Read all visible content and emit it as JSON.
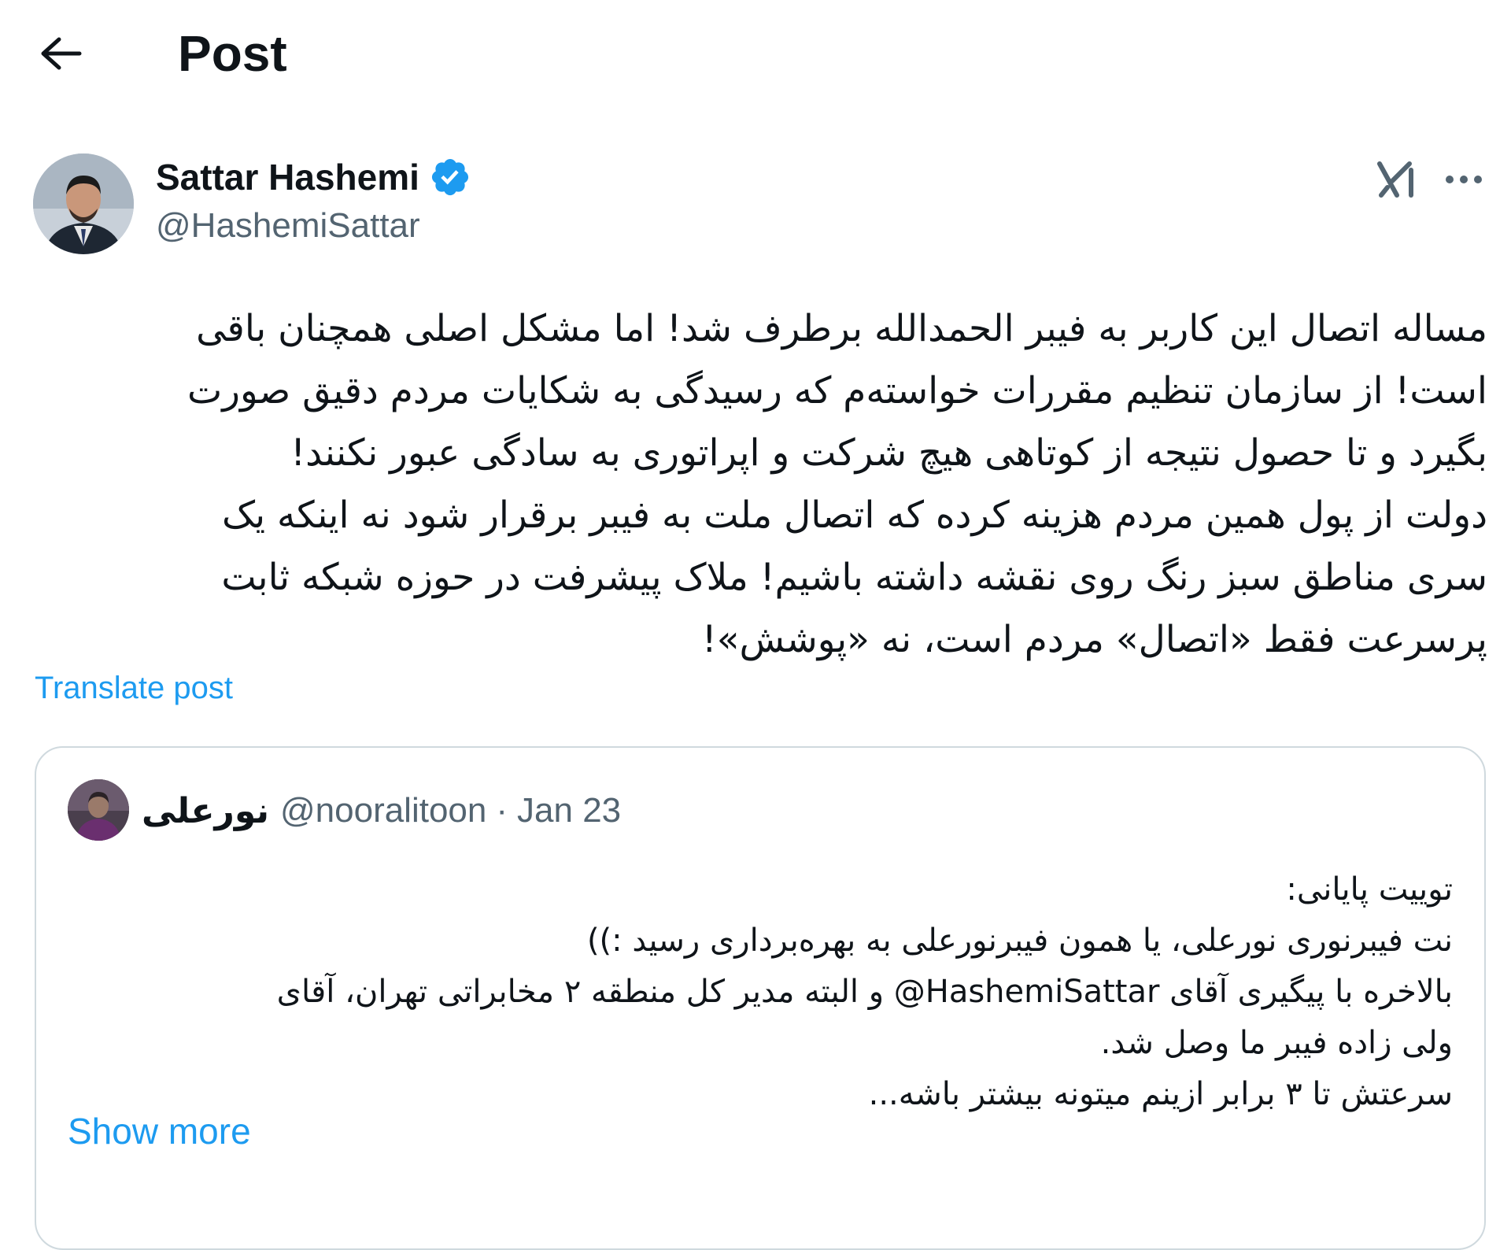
{
  "header": {
    "title": "Post",
    "back_icon": "arrow-left-icon"
  },
  "author": {
    "name": "Sattar Hashemi",
    "handle": "@HashemiSattar",
    "verified_color": "#1d9bf0"
  },
  "actions": {
    "grok_icon": "grok-icon",
    "more_icon": "more-horizontal-icon"
  },
  "post": {
    "lines": [
      "مساله اتصال این کاربر به فیبر الحمدالله برطرف شد! اما مشکل اصلی همچنان باقی",
      "است! از سازمان تنظیم مقررات خواسته‌م که رسیدگی به شکایات مردم دقیق صورت",
      "بگیرد و تا حصول نتیجه از کوتاهی هیچ شرکت و اپراتوری به سادگی عبور نکنند!",
      "دولت از پول همین مردم هزینه کرده که اتصال ملت به فیبر برقرار شود نه اینکه یک",
      "سری مناطق سبز رنگ روی نقشه داشته باشیم! ملاک پیشرفت در حوزه شبکه ثابت",
      "پرسرعت فقط «اتصال» مردم است، نه «پوشش»!"
    ],
    "translate_label": "Translate post"
  },
  "quote": {
    "name": "نورعلی",
    "handle": "@nooralitoon",
    "separator": "·",
    "date": "Jan 23",
    "lines": [
      "توییت پایانی:",
      "نت فیبرنوری نورعلی، یا همون فیبرنورعلی به بهره‌برداری رسید :))",
      "بالاخره با پیگیری آقای HashemiSattar@  و البته مدیر کل منطقه ۲ مخابراتی تهران، آقای",
      "ولی زاده فیبر ما وصل شد.",
      "سرعتش تا ۳ برابر ازینم میتونه بیشتر باشه..."
    ],
    "show_more_label": "Show more"
  },
  "colors": {
    "link": "#1d9bf0",
    "secondary_text": "#536471",
    "border": "#cfd9de",
    "text": "#0f1419"
  }
}
